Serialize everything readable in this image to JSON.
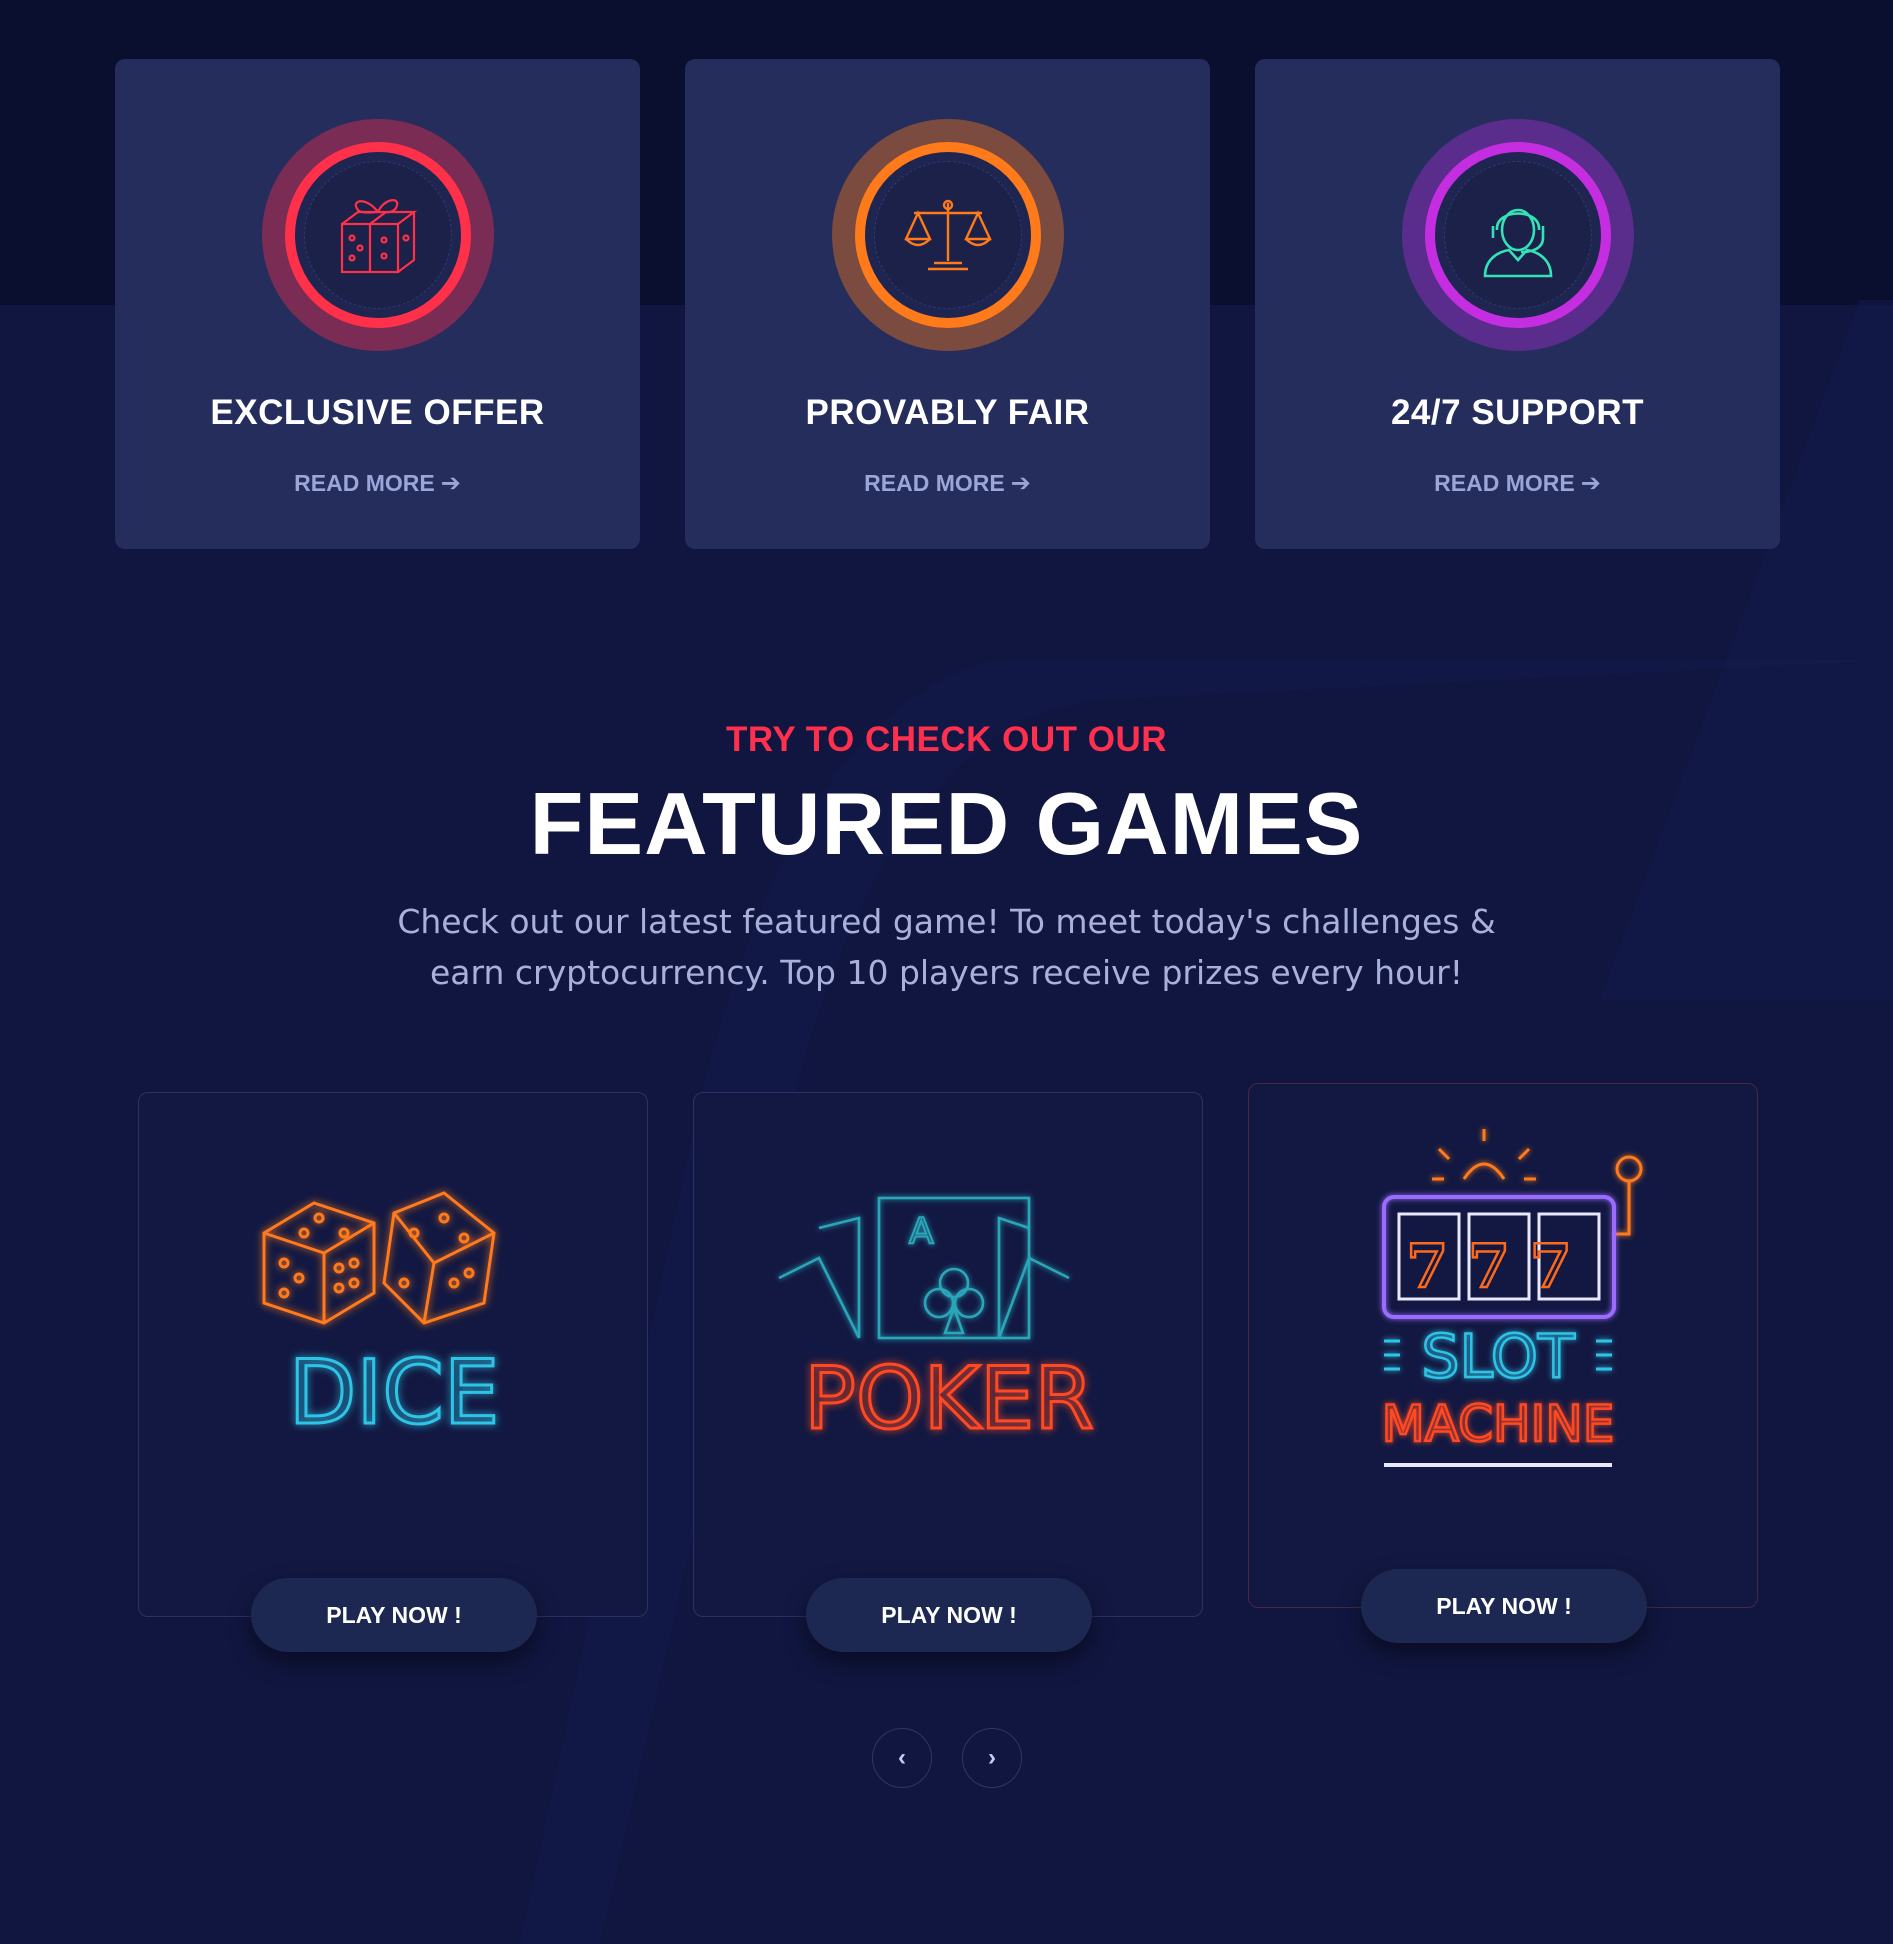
{
  "features": [
    {
      "title": "EXCLUSIVE OFFER",
      "link": "READ MORE",
      "icon": "gift-icon",
      "accent": "#ff3049"
    },
    {
      "title": "PROVABLY FAIR",
      "link": "READ MORE",
      "icon": "scales-icon",
      "accent": "#ff7a1a"
    },
    {
      "title": "24/7 SUPPORT",
      "link": "READ MORE",
      "icon": "support-agent-icon",
      "accent": "#c52ee0"
    }
  ],
  "section": {
    "eyebrow": "TRY TO CHECK OUT OUR",
    "title": "FEATURED GAMES",
    "lead": "Check out our latest featured game! To meet today's challenges & earn cryptocurrency. Top 10 players receive prizes every hour!"
  },
  "games": [
    {
      "art_text": "DICE",
      "button": "PLAY NOW !",
      "icon": "neon-dice-icon"
    },
    {
      "art_text": "POKER",
      "button": "PLAY NOW !",
      "icon": "neon-poker-cards-icon"
    },
    {
      "art_text_1": "SLOT",
      "art_text_2": "MACHINE",
      "reels": "777",
      "button": "PLAY NOW !",
      "icon": "neon-slot-machine-icon"
    }
  ],
  "colors": {
    "background": "#101640",
    "card": "#252d5c",
    "eyebrow": "#ff2f4e",
    "neon_blue": "#2ec4e6",
    "neon_orange": "#ff7a1a",
    "neon_purple": "#9b6bff"
  }
}
